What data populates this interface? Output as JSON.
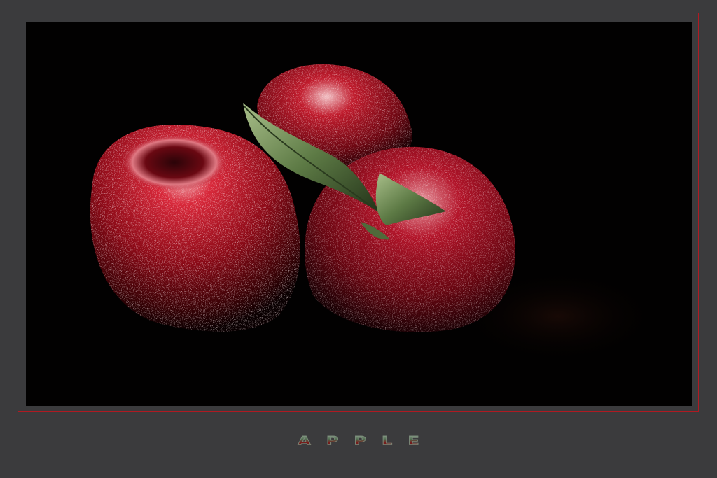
{
  "caption": {
    "title": "APPLE"
  },
  "colors": {
    "background": "#3b3b3d",
    "frame_border": "#b01a22",
    "photo_background": "#020101",
    "apple_red": "#a8121f",
    "leaf_green": "#6f8a55"
  },
  "image": {
    "subject": "three-red-apples-with-leaf"
  }
}
